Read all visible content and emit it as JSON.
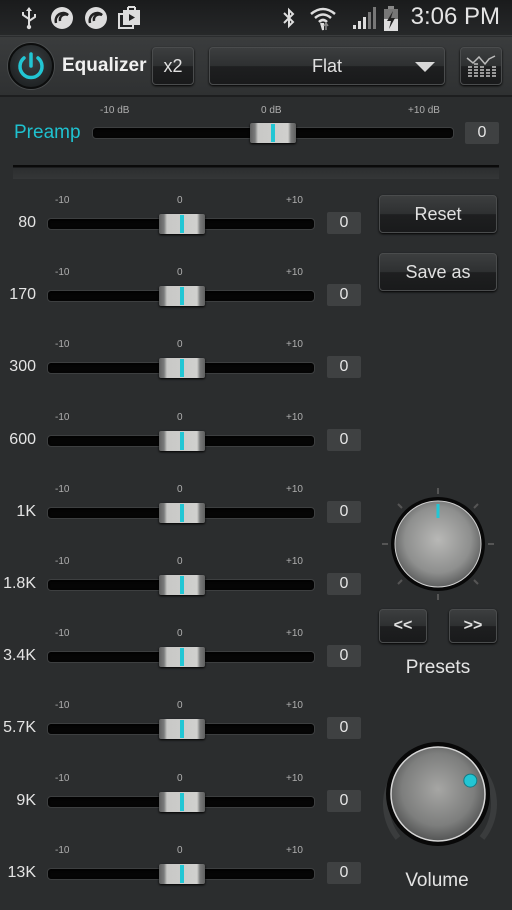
{
  "status_bar": {
    "left_icons": [
      "usb-icon",
      "app-notification-icon",
      "app-notification-icon",
      "play-store-icon"
    ],
    "right_icons": [
      "bluetooth-icon",
      "wifi-icon",
      "signal-icon",
      "battery-charging-icon"
    ],
    "time": "3:06 PM"
  },
  "toolbar": {
    "power_icon": "power-icon",
    "title": "Equalizer",
    "x2_label": "x2",
    "preset_selected": "Flat",
    "visualizer_icon": "visualizer-icon"
  },
  "preamp": {
    "label": "Preamp",
    "tick_min": "-10 dB",
    "tick_mid": "0 dB",
    "tick_max": "+10 dB",
    "value": "0",
    "level": 0,
    "range": [
      -10,
      10
    ]
  },
  "bands": [
    {
      "label": "80",
      "tick_min": "-10",
      "tick_mid": "0",
      "tick_max": "+10",
      "value": "0",
      "level": 0
    },
    {
      "label": "170",
      "tick_min": "-10",
      "tick_mid": "0",
      "tick_max": "+10",
      "value": "0",
      "level": 0
    },
    {
      "label": "300",
      "tick_min": "-10",
      "tick_mid": "0",
      "tick_max": "+10",
      "value": "0",
      "level": 0
    },
    {
      "label": "600",
      "tick_min": "-10",
      "tick_mid": "0",
      "tick_max": "+10",
      "value": "0",
      "level": 0
    },
    {
      "label": "1K",
      "tick_min": "-10",
      "tick_mid": "0",
      "tick_max": "+10",
      "value": "0",
      "level": 0
    },
    {
      "label": "1.8K",
      "tick_min": "-10",
      "tick_mid": "0",
      "tick_max": "+10",
      "value": "0",
      "level": 0
    },
    {
      "label": "3.4K",
      "tick_min": "-10",
      "tick_mid": "0",
      "tick_max": "+10",
      "value": "0",
      "level": 0
    },
    {
      "label": "5.7K",
      "tick_min": "-10",
      "tick_mid": "0",
      "tick_max": "+10",
      "value": "0",
      "level": 0
    },
    {
      "label": "9K",
      "tick_min": "-10",
      "tick_mid": "0",
      "tick_max": "+10",
      "value": "0",
      "level": 0
    },
    {
      "label": "13K",
      "tick_min": "-10",
      "tick_mid": "0",
      "tick_max": "+10",
      "value": "0",
      "level": 0
    }
  ],
  "side": {
    "reset_label": "Reset",
    "save_as_label": "Save as",
    "prev_label": "<<",
    "next_label": ">>",
    "presets_caption": "Presets",
    "volume_caption": "Volume",
    "volume_level_fraction": 0.75
  },
  "colors": {
    "accent": "#1fc1cf",
    "background": "#2b2d2e"
  }
}
